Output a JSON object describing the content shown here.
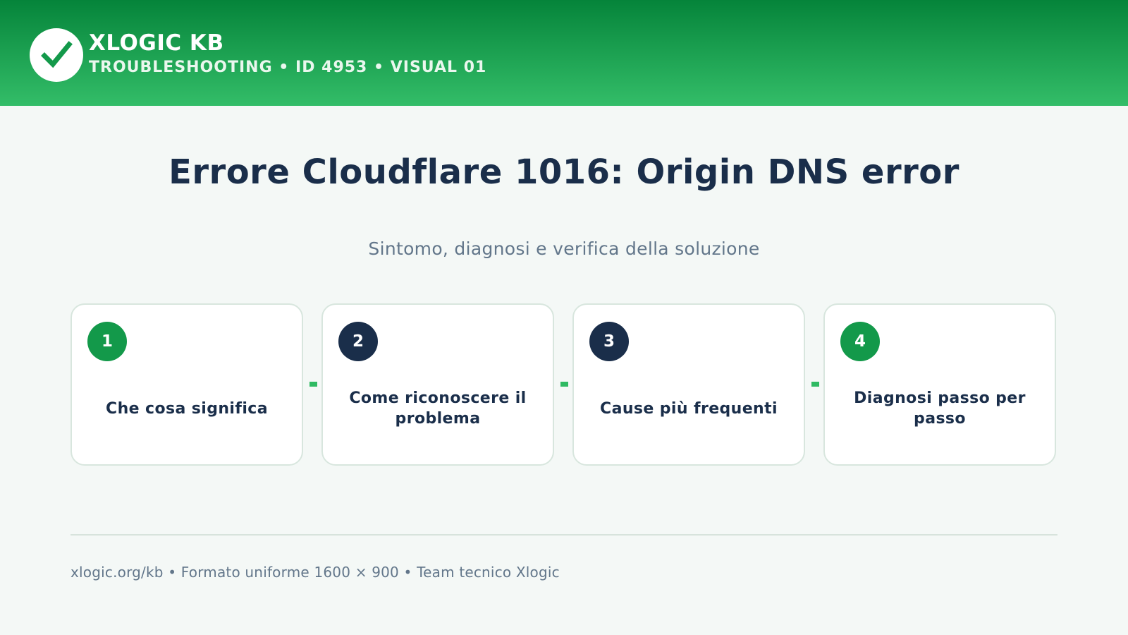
{
  "header": {
    "brand_title": "XLOGIC KB",
    "brand_subtitle": "TROUBLESHOOTING • ID 4953 • VISUAL 01",
    "logo_icon": "check-icon",
    "gradient_colors": [
      "#05843a",
      "#33bd68"
    ]
  },
  "main": {
    "title": "Errore Cloudflare 1016: Origin DNS error",
    "subtitle": "Sintomo, diagnosi e verifica della soluzione"
  },
  "steps": [
    {
      "number": "1",
      "label": "Che cosa significa",
      "badge_color": "#13994a"
    },
    {
      "number": "2",
      "label": "Come riconoscere il problema",
      "badge_color": "#1a2e4a"
    },
    {
      "number": "3",
      "label": "Cause più frequenti",
      "badge_color": "#1a2e4a"
    },
    {
      "number": "4",
      "label": "Diagnosi passo per passo",
      "badge_color": "#13994a"
    }
  ],
  "footer": {
    "text": "xlogic.org/kb • Formato uniforme 1600 × 900 • Team tecnico Xlogic"
  }
}
